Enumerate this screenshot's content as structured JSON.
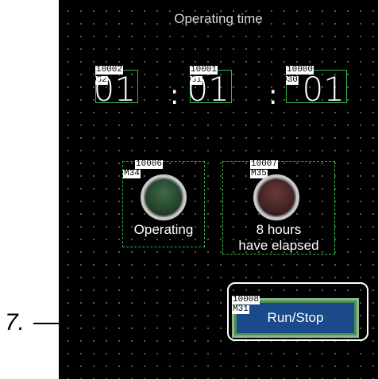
{
  "screen_title": "Operating time",
  "time_displays": [
    {
      "device": "10002",
      "sub": "D32",
      "value": "01"
    },
    {
      "device": "10001",
      "sub": "D31",
      "value": "01"
    },
    {
      "device": "10000",
      "sub": "D30",
      "value": "01"
    }
  ],
  "separator": ":",
  "lamps": [
    {
      "device": "10006",
      "sub": "M34",
      "label": "Operating",
      "color": "#23402a"
    },
    {
      "device": "10007",
      "sub": "M35",
      "label_line1": "8 hours",
      "label_line2": "have elapsed",
      "color": "#3e2121"
    }
  ],
  "run_stop": {
    "device": "10008",
    "sub": "M31",
    "label": "Run/Stop",
    "color": "#1b4a8a"
  },
  "callout": "7."
}
